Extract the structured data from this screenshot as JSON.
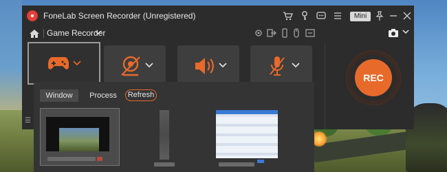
{
  "app": {
    "title": "FoneLab Screen Recorder (Unregistered)",
    "mini_label": "Mini",
    "titlebar_icons": [
      "cart-icon",
      "key-icon",
      "chat-icon",
      "menu-icon",
      "pin-icon",
      "minimize-icon",
      "close-icon"
    ]
  },
  "toolbar": {
    "mode_label": "Game Recorder",
    "icons": [
      "settings-icon",
      "export-icon",
      "mobile-icon",
      "mouse-icon",
      "stretch-icon"
    ]
  },
  "sources": [
    {
      "name": "game-controller",
      "active": true
    },
    {
      "name": "webcam",
      "active": false
    },
    {
      "name": "system-sound",
      "active": false
    },
    {
      "name": "microphone",
      "active": false
    }
  ],
  "record_button": {
    "label": "REC"
  },
  "panel": {
    "tabs": [
      {
        "label": "Window",
        "selected": true
      },
      {
        "label": "Process",
        "selected": false
      }
    ],
    "refresh_label": "Refresh"
  },
  "colors": {
    "accent": "#e86a2a",
    "window_bg": "#2c2c2c",
    "panel_bg": "#343434"
  }
}
